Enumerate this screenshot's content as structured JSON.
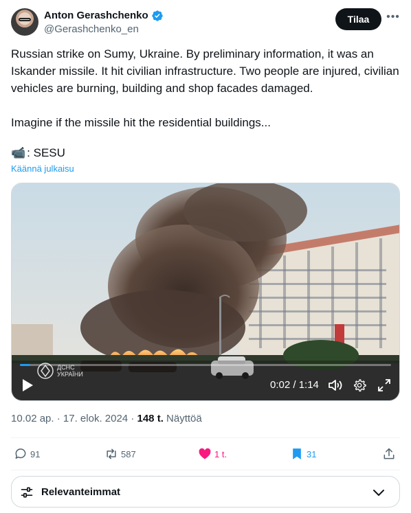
{
  "author": {
    "display_name": "Anton Gerashchenko",
    "handle": "@Gerashchenko_en",
    "verified": true,
    "avatar_icon": "profile-photo"
  },
  "follow_label": "Tilaa",
  "more_icon": "more-horizontal-icon",
  "tweet": {
    "text": "Russian strike on Sumy, Ukraine. By preliminary information, it was an Iskander missile. It hit civilian infrastructure. Two people are injured, civilian vehicles are burning, building and shop facades damaged.\n\nImagine if the missile hit the residential buildings...",
    "credit_emoji": "📹",
    "credit_text": ": SESU",
    "translate_label": "Käännä julkaisu"
  },
  "video": {
    "time_display": "0:02 / 1:14",
    "progress": 0.027,
    "watermark_line1": "ДСНС",
    "watermark_line2": "УКРАЇНИ"
  },
  "meta": {
    "time": "10.02 ap.",
    "separator": "·",
    "date": "17. elok. 2024",
    "views_count": "148 t.",
    "views_label": "Näyttöä"
  },
  "actions": {
    "replies": "91",
    "reposts": "587",
    "likes": "1 t.",
    "bookmarks": "31"
  },
  "colors": {
    "accent": "#1d9bf0",
    "like": "#f91880",
    "repost": "#00ba7c",
    "text": "#0f1419",
    "muted": "#536471"
  },
  "sort": {
    "label": "Relevanteimmat"
  }
}
